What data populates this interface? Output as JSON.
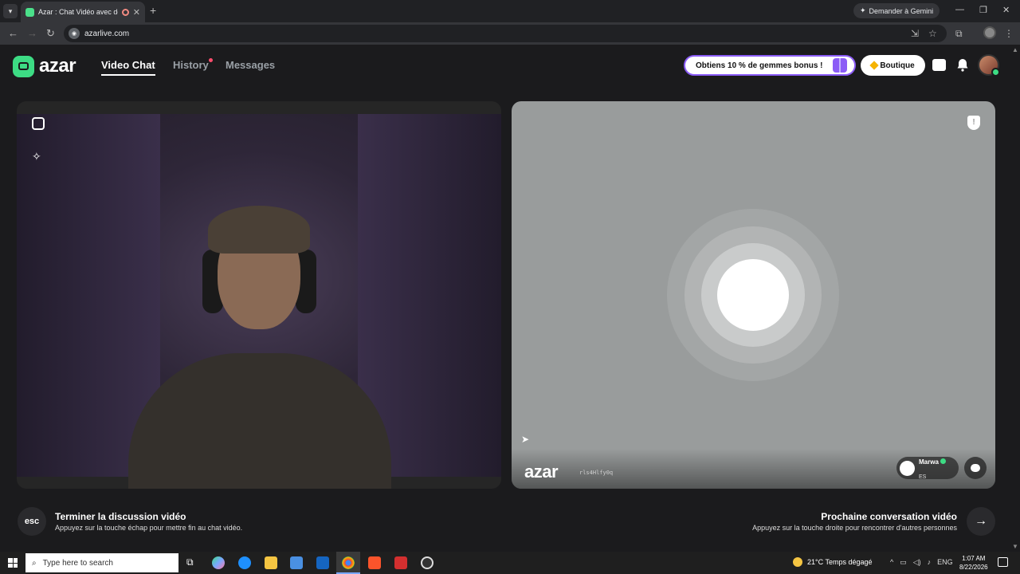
{
  "browser": {
    "tab_title": "Azar : Chat Vidéo avec de n",
    "tab_close": "✕",
    "new_tab": "+",
    "gemini_label": "Demander à Gemini",
    "url": "azarlive.com",
    "window_controls": [
      "—",
      "❐",
      "✕"
    ]
  },
  "app": {
    "logo_text": "azar",
    "nav": {
      "video_chat": "Video Chat",
      "history": "History",
      "messages": "Messages"
    },
    "promo_label": "Obtiens 10 % de gemmes bonus !",
    "shop_label": "Boutique"
  },
  "remote": {
    "watermark": "azar",
    "user_id": "rls4Hlfy0q",
    "partner_name": "Marwa",
    "partner_country": "ES",
    "report_glyph": "!"
  },
  "actions": {
    "esc_label": "esc",
    "end_title": "Terminer la discussion vidéo",
    "end_desc": "Appuyez sur la touche échap pour mettre fin au chat vidéo.",
    "next_title": "Prochaine conversation vidéo",
    "next_desc": "Appuyez sur la touche droite pour rencontrer d'autres personnes",
    "next_glyph": "→"
  },
  "taskbar": {
    "search_placeholder": "Type here to search",
    "weather": "21°C  Temps dégagé",
    "language": "ENG",
    "time": "1:07 AM",
    "date": "8/22/2026"
  },
  "colors": {
    "brand_green": "#3ddc84",
    "promo_purple": "#8b5cf6",
    "notification_red": "#ff4d6d"
  }
}
